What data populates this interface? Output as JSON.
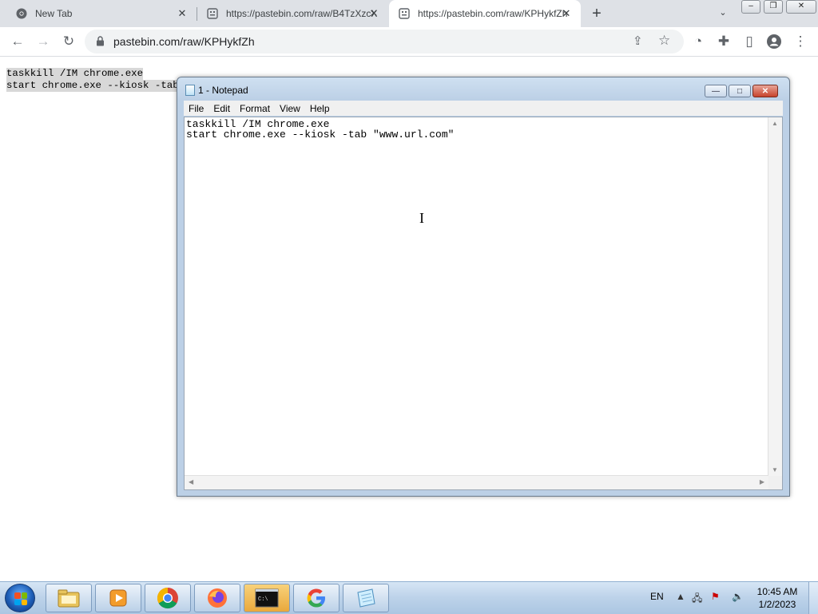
{
  "browser": {
    "tabs": [
      {
        "label": "New Tab",
        "icon": "chrome-icon",
        "active": false
      },
      {
        "label": "https://pastebin.com/raw/B4TzXzcX",
        "icon": "pastebin-icon",
        "active": false
      },
      {
        "label": "https://pastebin.com/raw/KPHykfZh",
        "icon": "pastebin-icon",
        "active": true
      }
    ],
    "url": "pastebin.com/raw/KPHykfZh"
  },
  "page": {
    "lines": [
      "taskkill /IM chrome.exe",
      "start chrome.exe --kiosk -tab"
    ]
  },
  "notepad": {
    "title": "1 - Notepad",
    "menu": [
      "File",
      "Edit",
      "Format",
      "View",
      "Help"
    ],
    "lines": [
      "taskkill /IM chrome.exe",
      "start chrome.exe --kiosk -tab \"www.url.com\""
    ]
  },
  "taskbar": {
    "apps": [
      "file-explorer-icon",
      "media-player-icon",
      "chrome-icon",
      "firefox-icon",
      "command-prompt-icon",
      "google-icon",
      "notepad-icon"
    ],
    "tray": {
      "language": "EN",
      "time": "10:45 AM",
      "date": "1/2/2023"
    }
  }
}
